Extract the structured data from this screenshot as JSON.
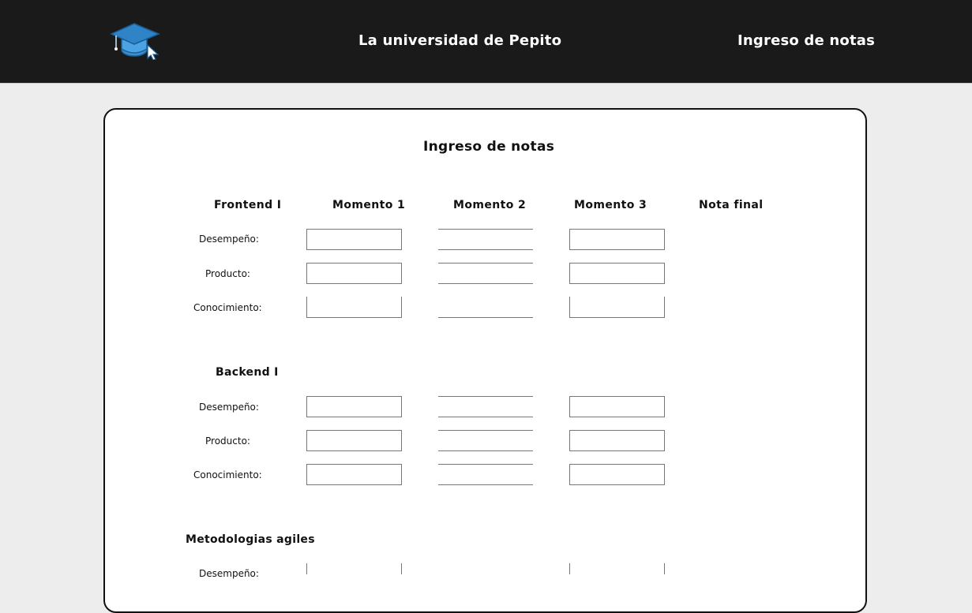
{
  "header": {
    "site_title": "La universidad de Pepito",
    "nav_link": "Ingreso de notas",
    "logo_icon": "graduation-cap-cursor-icon",
    "background": "#1a1a1a"
  },
  "main": {
    "title": "Ingreso de notas",
    "columns": [
      "Momento 1",
      "Momento 2",
      "Momento 3",
      "Nota final"
    ],
    "subjects": [
      {
        "name": "Frontend I",
        "rows": [
          {
            "label": "Desempeño:",
            "m1": "",
            "m2": "",
            "m3": ""
          },
          {
            "label": "Producto:",
            "m1": "",
            "m2": "",
            "m3": ""
          },
          {
            "label": "Conocimiento:",
            "m1": "",
            "m2": "",
            "m3": ""
          }
        ]
      },
      {
        "name": "Backend I",
        "rows": [
          {
            "label": "Desempeño:",
            "m1": "",
            "m2": "",
            "m3": ""
          },
          {
            "label": "Producto:",
            "m1": "",
            "m2": "",
            "m3": ""
          },
          {
            "label": "Conocimiento:",
            "m1": "",
            "m2": "",
            "m3": ""
          }
        ]
      },
      {
        "name": "Metodologias agiles",
        "rows": [
          {
            "label": "Desempeño:"
          }
        ]
      }
    ]
  }
}
